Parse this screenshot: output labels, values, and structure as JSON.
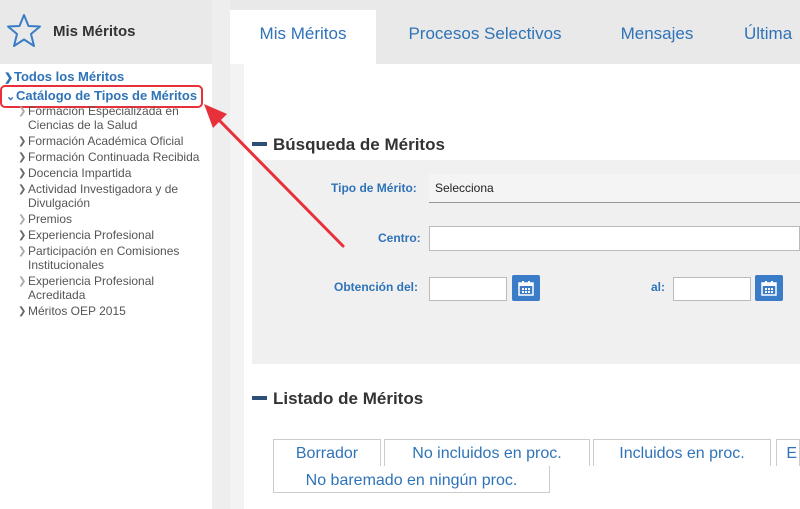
{
  "sidebar": {
    "title": "Mis Méritos",
    "all_merits": "Todos los Méritos",
    "catalog": "Catálogo de Tipos de Méritos",
    "items": [
      {
        "label": "Formación Especializada en Ciencias de la Salud",
        "enabled": false
      },
      {
        "label": "Formación Académica Oficial",
        "enabled": true
      },
      {
        "label": "Formación Continuada Recibida",
        "enabled": true
      },
      {
        "label": "Docencia Impartida",
        "enabled": true
      },
      {
        "label": "Actividad Investigadora y de Divulgación",
        "enabled": true
      },
      {
        "label": "Premios",
        "enabled": false
      },
      {
        "label": "Experiencia Profesional",
        "enabled": true
      },
      {
        "label": "Participación en Comisiones Institucionales",
        "enabled": false
      },
      {
        "label": "Experiencia Profesional Acreditada",
        "enabled": false
      },
      {
        "label": "Méritos OEP 2015",
        "enabled": true
      }
    ]
  },
  "tabs": [
    "Mis Méritos",
    "Procesos Selectivos",
    "Mensajes",
    "Última"
  ],
  "search": {
    "title": "Búsqueda de Méritos",
    "tipo_label": "Tipo de Mérito:",
    "tipo_value": "Selecciona",
    "centro_label": "Centro:",
    "obtencion_label": "Obtención del:",
    "al_label": "al:"
  },
  "listado": {
    "title": "Listado de Méritos",
    "tabs": [
      "Borrador",
      "No incluidos en proc.",
      "Incluidos en proc.",
      "E"
    ],
    "tab_row2": "No baremado en ningún proc."
  },
  "colors": {
    "accent": "#2f73b8",
    "annotation": "#e8303a",
    "calendar_button": "#3a7cc7"
  }
}
